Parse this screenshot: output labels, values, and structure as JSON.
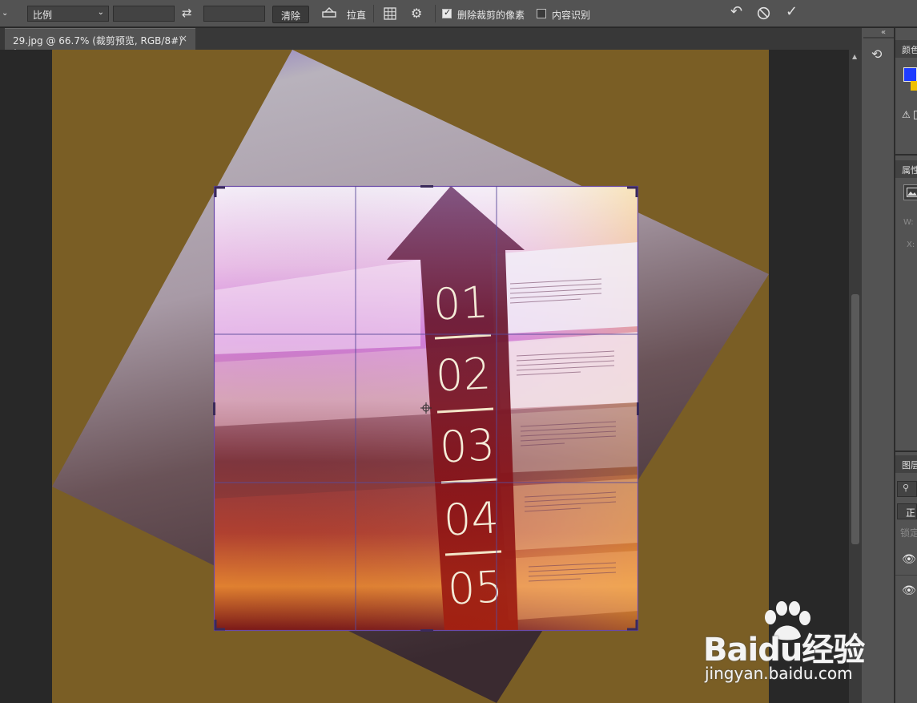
{
  "options_bar": {
    "ratio_select": "比例",
    "clear_button": "清除",
    "straighten_label": "拉直",
    "delete_cropped_label": "删除裁剪的像素",
    "delete_cropped_checked": true,
    "content_aware_label": "内容识别",
    "content_aware_checked": false
  },
  "document_tab": {
    "title": "29.jpg @ 66.7% (裁剪预览, RGB/8#) *",
    "close": "×"
  },
  "artwork": {
    "numbers": [
      "01",
      "02",
      "03",
      "04",
      "05"
    ]
  },
  "panels": {
    "color_tab": "颜色",
    "properties_tab": "属性",
    "properties_w": "W:",
    "properties_x": "X:",
    "layers_tab": "图层",
    "blend_mode": "正常",
    "lock_label": "锁定",
    "foreground_color": "#1e3cff",
    "background_color": "#f0c000"
  },
  "watermark": {
    "brand": "Baidu经验",
    "url": "jingyan.baidu.com"
  }
}
